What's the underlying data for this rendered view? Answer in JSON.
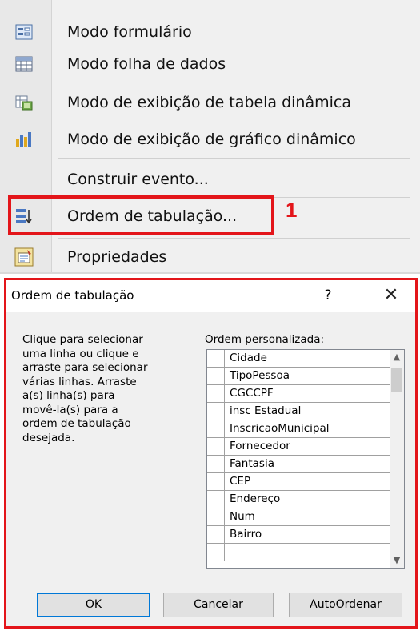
{
  "menu": {
    "items": [
      {
        "label": "Modo formulário",
        "icon": "form-view-icon"
      },
      {
        "label": "Modo folha de dados",
        "icon": "datasheet-view-icon"
      },
      {
        "label": "Modo de exibição de tabela dinâmica",
        "icon": "pivot-table-icon"
      },
      {
        "label": "Modo de exibição de gráfico dinâmico",
        "icon": "pivot-chart-icon"
      },
      {
        "label": "Construir evento...",
        "icon": ""
      },
      {
        "label": "Ordem de tabulação...",
        "icon": "tab-order-icon"
      },
      {
        "label": "Propriedades",
        "icon": "properties-icon"
      }
    ],
    "annotation_number": "1",
    "highlight_color": "#e3151a"
  },
  "dialog": {
    "title": "Ordem de tabulação",
    "help_label": "?",
    "close_label": "✕",
    "instructions": [
      "Clique para selecionar",
      "uma linha ou clique e",
      "arraste para selecionar",
      "várias linhas. Arraste",
      "a(s) linha(s) para",
      "movê-la(s) para a",
      "ordem de tabulação",
      "desejada."
    ],
    "list_label": "Ordem personalizada:",
    "list_items": [
      "Cidade",
      "TipoPessoa",
      "CGCCPF",
      "insc Estadual",
      "InscricaoMunicipal",
      "Fornecedor",
      "Fantasia",
      "CEP",
      "Endereço",
      "Num",
      "Bairro"
    ],
    "buttons": {
      "ok": "OK",
      "cancel": "Cancelar",
      "auto": "AutoOrdenar"
    },
    "accent_color": "#0078d7"
  }
}
